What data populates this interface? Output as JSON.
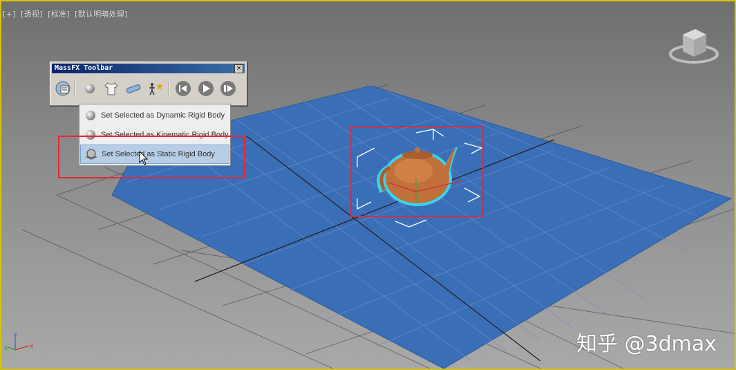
{
  "viewport": {
    "labels": [
      "[+]",
      "[透视]",
      "[标准]",
      "[默认明暗处理]"
    ],
    "border_color": "#d8c400",
    "background_top": "#6f6f6f",
    "background_bottom": "#a9a9a9"
  },
  "massfx_toolbar": {
    "title": "MassFX Toolbar",
    "close_label": "×",
    "buttons": [
      {
        "icon": "world-settings-icon"
      },
      {
        "icon": "rigid-body-sphere-icon"
      },
      {
        "icon": "cloth-shirt-icon"
      },
      {
        "icon": "constraint-icon"
      },
      {
        "icon": "ragdoll-icon"
      },
      {
        "icon": "reset-simulation-icon"
      },
      {
        "icon": "play-simulation-icon"
      },
      {
        "icon": "step-simulation-icon"
      }
    ]
  },
  "flyout": {
    "items": [
      {
        "label": "Set Selected as Dynamic Rigid Body",
        "icon": "sphere-icon",
        "selected": false
      },
      {
        "label": "Set Selected as Kinematic Rigid Body",
        "icon": "sphere-icon",
        "selected": false
      },
      {
        "label": "Set Selected as Static Rigid Body",
        "icon": "static-sphere-icon",
        "selected": true
      }
    ]
  },
  "plane": {
    "color": "#3a6fb8"
  },
  "teapot": {
    "color": "#c0703a",
    "outline_color": "#39d5f0"
  },
  "highlight_color": "#e0283a",
  "watermark": "知乎 @3dmax",
  "axis": {
    "x": "x",
    "y": "y",
    "z": "z"
  }
}
